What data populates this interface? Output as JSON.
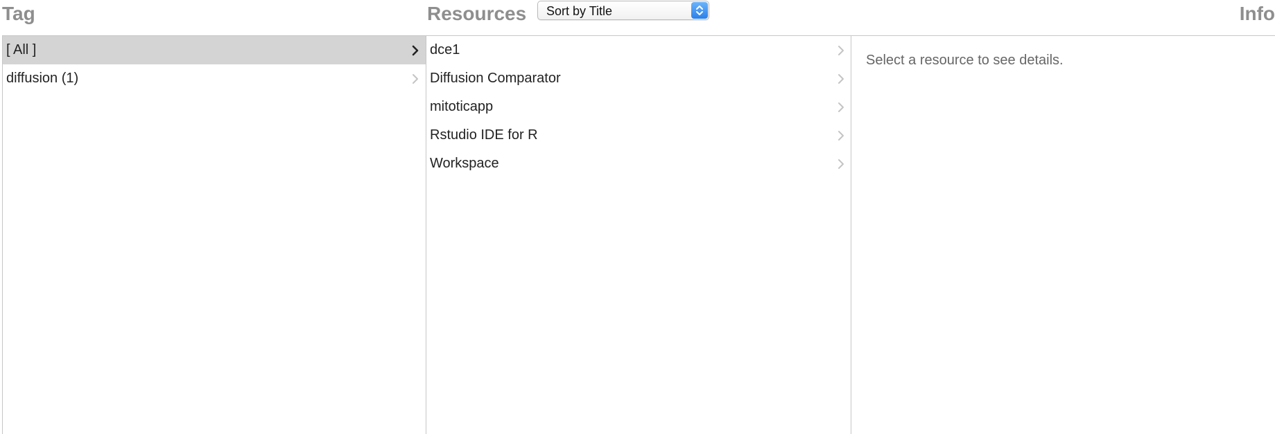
{
  "tag_column": {
    "title": "Tag",
    "items": [
      {
        "label": "[ All ]",
        "selected": true
      },
      {
        "label": "diffusion (1)",
        "selected": false
      }
    ]
  },
  "resources_column": {
    "title": "Resources",
    "sort": {
      "selected": "Sort by Title"
    },
    "items": [
      {
        "label": "dce1"
      },
      {
        "label": "Diffusion Comparator"
      },
      {
        "label": "mitoticapp"
      },
      {
        "label": "Rstudio IDE for R"
      },
      {
        "label": "Workspace"
      }
    ]
  },
  "info_column": {
    "title": "Info",
    "empty_message": "Select a resource to see details."
  },
  "icons": {
    "chevron": "chevron-right-icon",
    "select_arrows": "up-down-arrows-icon"
  },
  "colors": {
    "title_gray": "#8e8e8e",
    "selected_row": "#d4d4d4",
    "select_accent": "#2a80ea",
    "chevron_active": "#222222",
    "chevron_inactive": "#c4c4c4"
  }
}
